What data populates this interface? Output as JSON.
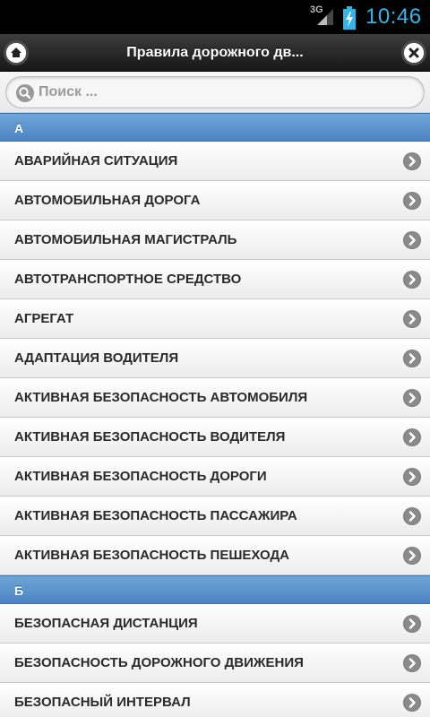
{
  "statusbar": {
    "network": "3G",
    "time": "10:46"
  },
  "header": {
    "title": "Правила дорожного дв...",
    "home_icon": "home-icon",
    "close_icon": "close-icon"
  },
  "search": {
    "placeholder": "Поиск ..."
  },
  "sections": [
    {
      "letter": "А",
      "items": [
        "АВАРИЙНАЯ СИТУАЦИЯ",
        "АВТОМОБИЛЬНАЯ ДОРОГА",
        "АВТОМОБИЛЬНАЯ МАГИСТРАЛЬ",
        "АВТОТРАНСПОРТНОЕ СРЕДСТВО",
        "АГРЕГАТ",
        "АДАПТАЦИЯ ВОДИТЕЛЯ",
        "АКТИВНАЯ БЕЗОПАСНОСТЬ АВТОМОБИЛЯ",
        "АКТИВНАЯ БЕЗОПАСНОСТЬ ВОДИТЕЛЯ",
        "АКТИВНАЯ БЕЗОПАСНОСТЬ ДОРОГИ",
        "АКТИВНАЯ БЕЗОПАСНОСТЬ ПАССАЖИРА",
        "АКТИВНАЯ БЕЗОПАСНОСТЬ ПЕШЕХОДА"
      ]
    },
    {
      "letter": "Б",
      "items": [
        "БЕЗОПАСНАЯ ДИСТАНЦИЯ",
        "БЕЗОПАСНОСТЬ ДОРОЖНОГО ДВИЖЕНИЯ",
        "БЕЗОПАСНЫЙ ИНТЕРВАЛ"
      ]
    }
  ],
  "colors": {
    "divider": "#5b93cd",
    "clock": "#33b5e5",
    "header": "#222222"
  }
}
